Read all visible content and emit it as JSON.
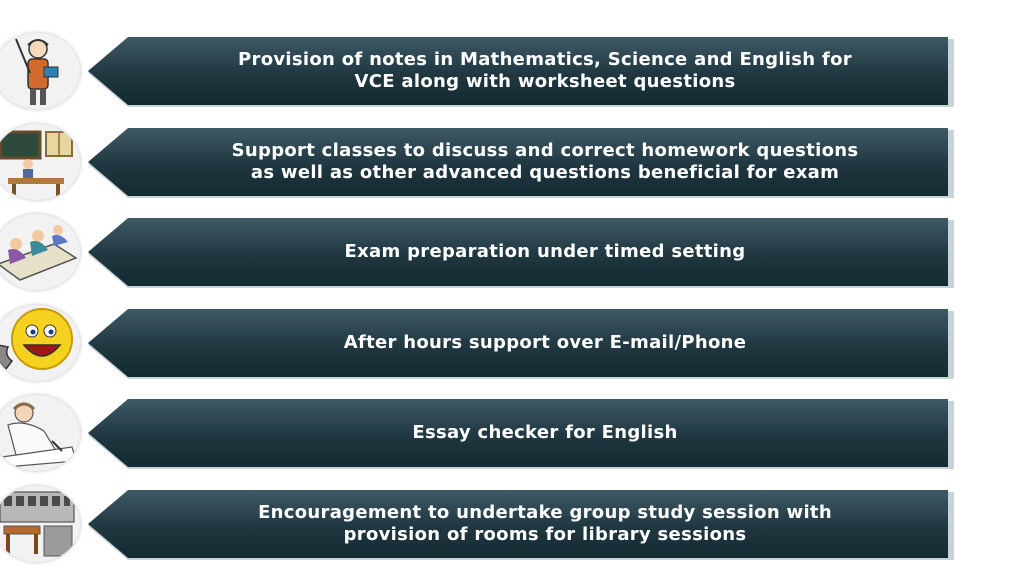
{
  "items": [
    {
      "text": "Provision of notes in   Mathematics, Science and English for\nVCE along with worksheet questions",
      "icon": "teacher-icon"
    },
    {
      "text": "Support classes to discuss and correct homework questions\nas well as other advanced questions beneficial for exam",
      "icon": "classroom-icon"
    },
    {
      "text": "Exam preparation under timed setting",
      "icon": "exam-students-icon"
    },
    {
      "text": "After hours support over E-mail/Phone",
      "icon": "smiley-phone-icon"
    },
    {
      "text": "Essay checker for English",
      "icon": "writing-person-icon"
    },
    {
      "text": "Encouragement to undertake group study session with\nprovision of rooms for library sessions",
      "icon": "library-icon"
    }
  ],
  "colors": {
    "banner": "#203740",
    "text": "#ffffff"
  }
}
